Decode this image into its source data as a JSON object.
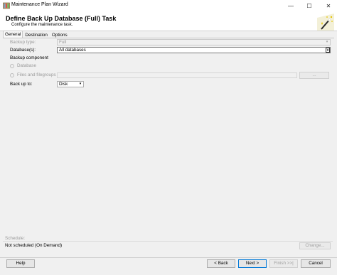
{
  "window": {
    "title": "Maintenance Plan Wizard",
    "controls": {
      "minimize": "—",
      "maximize": "☐",
      "close": "✕"
    }
  },
  "header": {
    "title": "Define Back Up Database (Full) Task",
    "subtitle": "Configure the maintenance task."
  },
  "tabs": [
    {
      "label": "General",
      "active": true
    },
    {
      "label": "Destination",
      "active": false
    },
    {
      "label": "Options",
      "active": false
    }
  ],
  "general": {
    "backup_type_label": "Backup type:",
    "backup_type_value": "Full",
    "databases_label": "Database(s):",
    "databases_value": "All databases",
    "backup_component_label": "Backup component",
    "database_option": "Database",
    "files_option": "Files and filegroups",
    "files_browse": "...",
    "backup_to_label": "Back up to:",
    "backup_to_value": "Disk"
  },
  "schedule": {
    "label": "Schedule:",
    "value": "Not scheduled (On Demand)",
    "change_button": "Change..."
  },
  "footer": {
    "help": "Help",
    "back": "< Back",
    "next": "Next >",
    "finish": "Finish >>|",
    "cancel": "Cancel"
  }
}
